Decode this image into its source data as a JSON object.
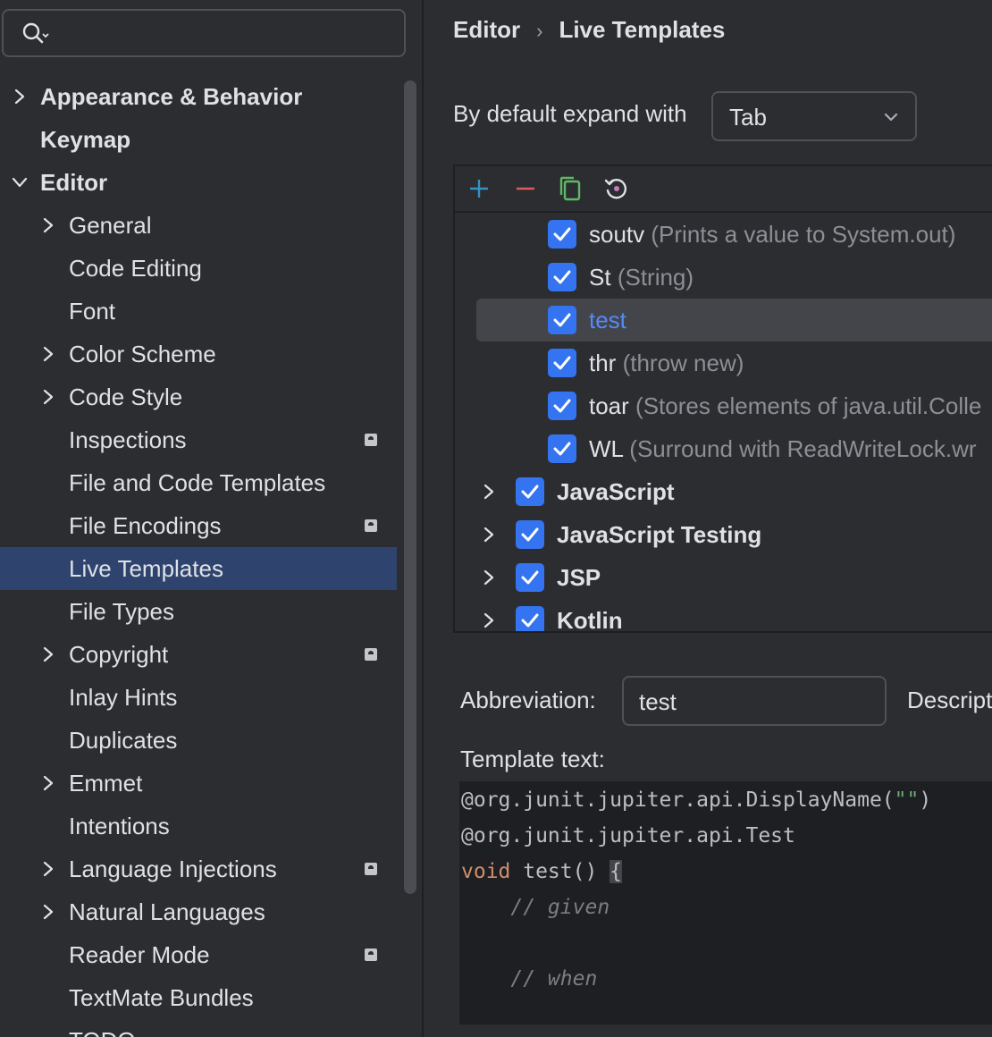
{
  "search": {
    "placeholder": ""
  },
  "sidebar": {
    "items": [
      {
        "label": "Appearance & Behavior",
        "chevron": "right",
        "level": 0,
        "bold": true
      },
      {
        "label": "Keymap",
        "chevron": "",
        "level": 0,
        "bold": true
      },
      {
        "label": "Editor",
        "chevron": "down",
        "level": 0,
        "bold": true
      },
      {
        "label": "General",
        "chevron": "right",
        "level": 1
      },
      {
        "label": "Code Editing",
        "chevron": "",
        "level": 1
      },
      {
        "label": "Font",
        "chevron": "",
        "level": 1
      },
      {
        "label": "Color Scheme",
        "chevron": "right",
        "level": 1
      },
      {
        "label": "Code Style",
        "chevron": "right",
        "level": 1
      },
      {
        "label": "Inspections",
        "chevron": "",
        "level": 1,
        "badge": true
      },
      {
        "label": "File and Code Templates",
        "chevron": "",
        "level": 1
      },
      {
        "label": "File Encodings",
        "chevron": "",
        "level": 1,
        "badge": true
      },
      {
        "label": "Live Templates",
        "chevron": "",
        "level": 1,
        "selected": true
      },
      {
        "label": "File Types",
        "chevron": "",
        "level": 1
      },
      {
        "label": "Copyright",
        "chevron": "right",
        "level": 1,
        "badge": true
      },
      {
        "label": "Inlay Hints",
        "chevron": "",
        "level": 1
      },
      {
        "label": "Duplicates",
        "chevron": "",
        "level": 1
      },
      {
        "label": "Emmet",
        "chevron": "right",
        "level": 1
      },
      {
        "label": "Intentions",
        "chevron": "",
        "level": 1
      },
      {
        "label": "Language Injections",
        "chevron": "right",
        "level": 1,
        "badge": true
      },
      {
        "label": "Natural Languages",
        "chevron": "right",
        "level": 1
      },
      {
        "label": "Reader Mode",
        "chevron": "",
        "level": 1,
        "badge": true
      },
      {
        "label": "TextMate Bundles",
        "chevron": "",
        "level": 1
      },
      {
        "label": "TODO",
        "chevron": "",
        "level": 1
      }
    ]
  },
  "breadcrumb": {
    "parent": "Editor",
    "separator": "›",
    "current": "Live Templates"
  },
  "expand": {
    "label": "By default expand with",
    "value": "Tab"
  },
  "toolbar": {
    "add": "+",
    "remove": "−"
  },
  "templates": [
    {
      "name": "soutv",
      "desc": "(Prints a value to System.out)",
      "checked": true
    },
    {
      "name": "St",
      "desc": "(String)",
      "checked": true
    },
    {
      "name": "test",
      "desc": "",
      "checked": true,
      "selected": true
    },
    {
      "name": "thr",
      "desc": "(throw new)",
      "checked": true
    },
    {
      "name": "toar",
      "desc": "(Stores elements of java.util.Colle",
      "checked": true
    },
    {
      "name": "WL",
      "desc": "(Surround with ReadWriteLock.wr",
      "checked": true
    }
  ],
  "groups": [
    {
      "name": "JavaScript",
      "checked": true
    },
    {
      "name": "JavaScript Testing",
      "checked": true
    },
    {
      "name": "JSP",
      "checked": true
    },
    {
      "name": "Kotlin",
      "checked": true
    }
  ],
  "abbreviation": {
    "label": "Abbreviation:",
    "value": "test"
  },
  "description": {
    "label": "Descript"
  },
  "template_text": {
    "label": "Template text:",
    "line1": "@org.junit.jupiter.api.DisplayName(",
    "line1_str": "\"\"",
    "line1_end": ")",
    "line2": "@org.junit.jupiter.api.Test",
    "line3_kw": "void",
    "line3": " test() ",
    "line3_brace": "{",
    "line4": "    // given",
    "line6": "    // when"
  },
  "colors": {
    "accent": "#3574f0",
    "selection": "#2e436e",
    "link": "#548af7"
  }
}
